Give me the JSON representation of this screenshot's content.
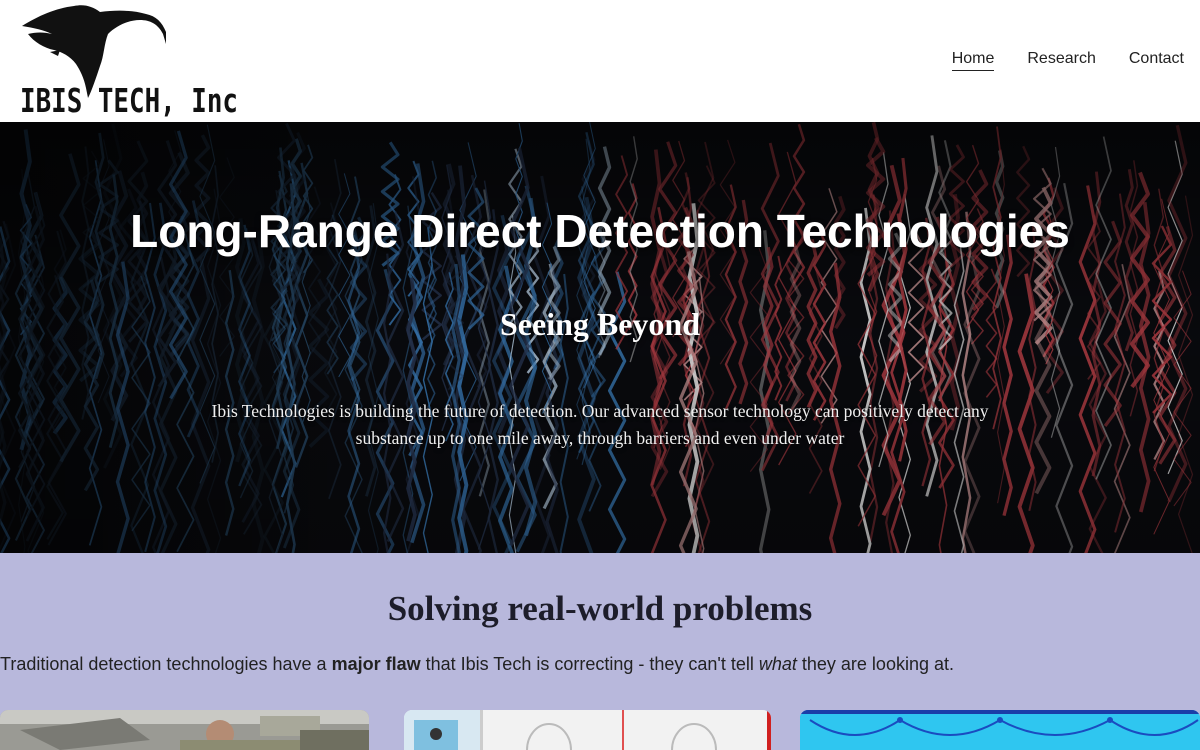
{
  "header": {
    "logo": {
      "text": "IBIS TECH, Inc",
      "icon": "ibis-bird-icon"
    },
    "nav": [
      {
        "label": "Home",
        "active": true
      },
      {
        "label": "Research",
        "active": false
      },
      {
        "label": "Contact",
        "active": false
      }
    ]
  },
  "hero": {
    "title": "Long-Range Direct Detection Technologies",
    "subtitle": "Seeing Beyond",
    "description": "Ibis Technologies is building the future of detection. Our advanced sensor technology can positively detect any substance up to one mile away, through barriers and even under water"
  },
  "problems": {
    "title": "Solving real-world problems",
    "text_before": "Traditional detection technologies have a ",
    "text_bold": "major flaw",
    "text_middle": " that Ibis Tech is correcting - they can't tell ",
    "text_italic": "what",
    "text_after": " they are looking at."
  },
  "colors": {
    "problems_bg": "#b8b8dc",
    "hero_bg": "#0a0b0f",
    "hero_red": "#c2424a",
    "hero_blue": "#3f86c9"
  }
}
